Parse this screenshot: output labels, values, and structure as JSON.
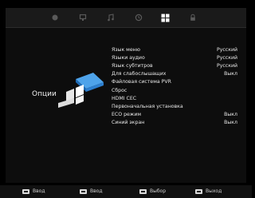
{
  "tabs": [
    {
      "icon": "picture-icon"
    },
    {
      "icon": "monitor-icon"
    },
    {
      "icon": "music-note-icon"
    },
    {
      "icon": "clock-icon"
    },
    {
      "icon": "grid-settings-icon",
      "active": true
    },
    {
      "icon": "lock-icon"
    }
  ],
  "section_title": "Опции",
  "menu": [
    {
      "label": "Язык меню",
      "value": "Русский"
    },
    {
      "label": "Языки аудио",
      "value": "Русский"
    },
    {
      "label": "Язык субтитров",
      "value": "Русский"
    },
    {
      "label": "Для слабослышащих",
      "value": "Выкл"
    },
    {
      "label": "Файловая система PVR",
      "value": ""
    },
    {
      "label": "Сброс",
      "value": ""
    },
    {
      "label": "HDMI CEC",
      "value": ""
    },
    {
      "label": "Первоначальная установка",
      "value": ""
    },
    {
      "label": "ECO режим",
      "value": "Выкл"
    },
    {
      "label": "Синий экран",
      "value": "Выкл"
    }
  ],
  "hints": [
    {
      "label": "Ввод"
    },
    {
      "label": "Ввод"
    },
    {
      "label": "Выбор"
    },
    {
      "label": "Выход"
    }
  ],
  "colors": {
    "accent": "#3a8fd9",
    "active_tab": "#ffffff",
    "inactive_tab": "#5a5a5a"
  }
}
